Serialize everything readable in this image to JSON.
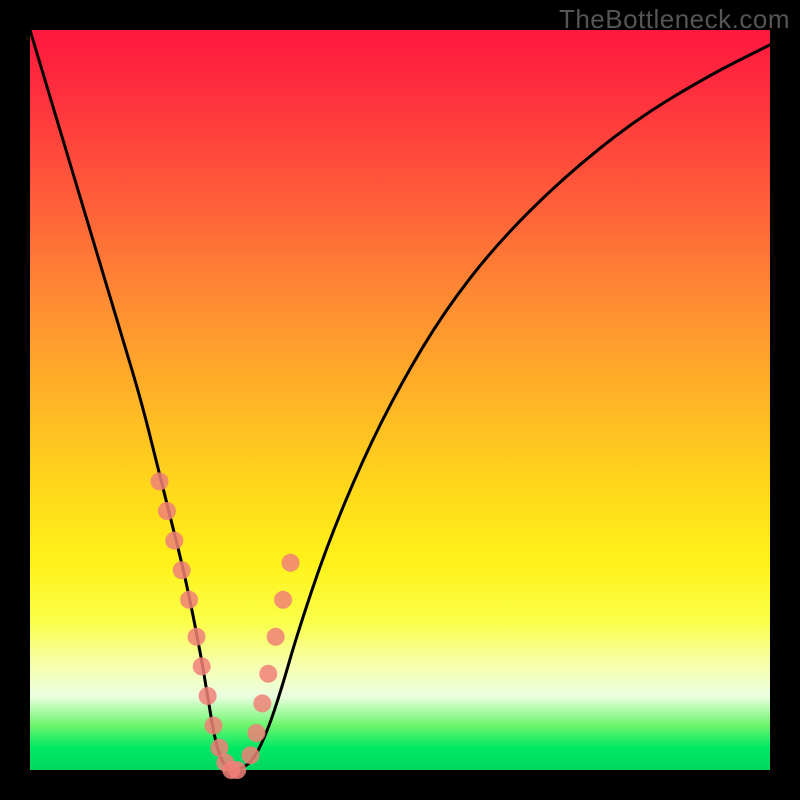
{
  "watermark": "TheBottleneck.com",
  "chart_data": {
    "type": "line",
    "title": "",
    "xlabel": "",
    "ylabel": "",
    "xlim": [
      0,
      100
    ],
    "ylim": [
      0,
      100
    ],
    "series": [
      {
        "name": "bottleneck-curve",
        "x": [
          0,
          3,
          6,
          9,
          12,
          15,
          17,
          19,
          21,
          23,
          24,
          25,
          26,
          27,
          28,
          30,
          32,
          34,
          36,
          40,
          45,
          50,
          56,
          63,
          72,
          82,
          92,
          100
        ],
        "values": [
          100,
          90,
          80,
          70,
          60,
          50,
          42,
          34,
          26,
          16,
          10,
          4,
          1,
          0,
          0,
          1,
          5,
          11,
          18,
          30,
          42,
          52,
          62,
          71,
          80,
          88,
          94,
          98
        ]
      },
      {
        "name": "highlight-dots",
        "x": [
          17.5,
          18.5,
          19.5,
          20.5,
          21.5,
          22.5,
          23.2,
          24.0,
          24.8,
          25.6,
          26.4,
          27.2,
          28.0,
          29.8,
          30.6,
          31.4,
          32.2,
          33.2,
          34.2,
          35.2
        ],
        "values": [
          39,
          35,
          31,
          27,
          23,
          18,
          14,
          10,
          6,
          3,
          1,
          0,
          0,
          2,
          5,
          9,
          13,
          18,
          23,
          28
        ]
      }
    ],
    "gradient_stops": [
      {
        "pos": 0,
        "color": "#ff173f"
      },
      {
        "pos": 50,
        "color": "#ffd81a"
      },
      {
        "pos": 86,
        "color": "#f6ffb0"
      },
      {
        "pos": 100,
        "color": "#00d860"
      }
    ]
  }
}
